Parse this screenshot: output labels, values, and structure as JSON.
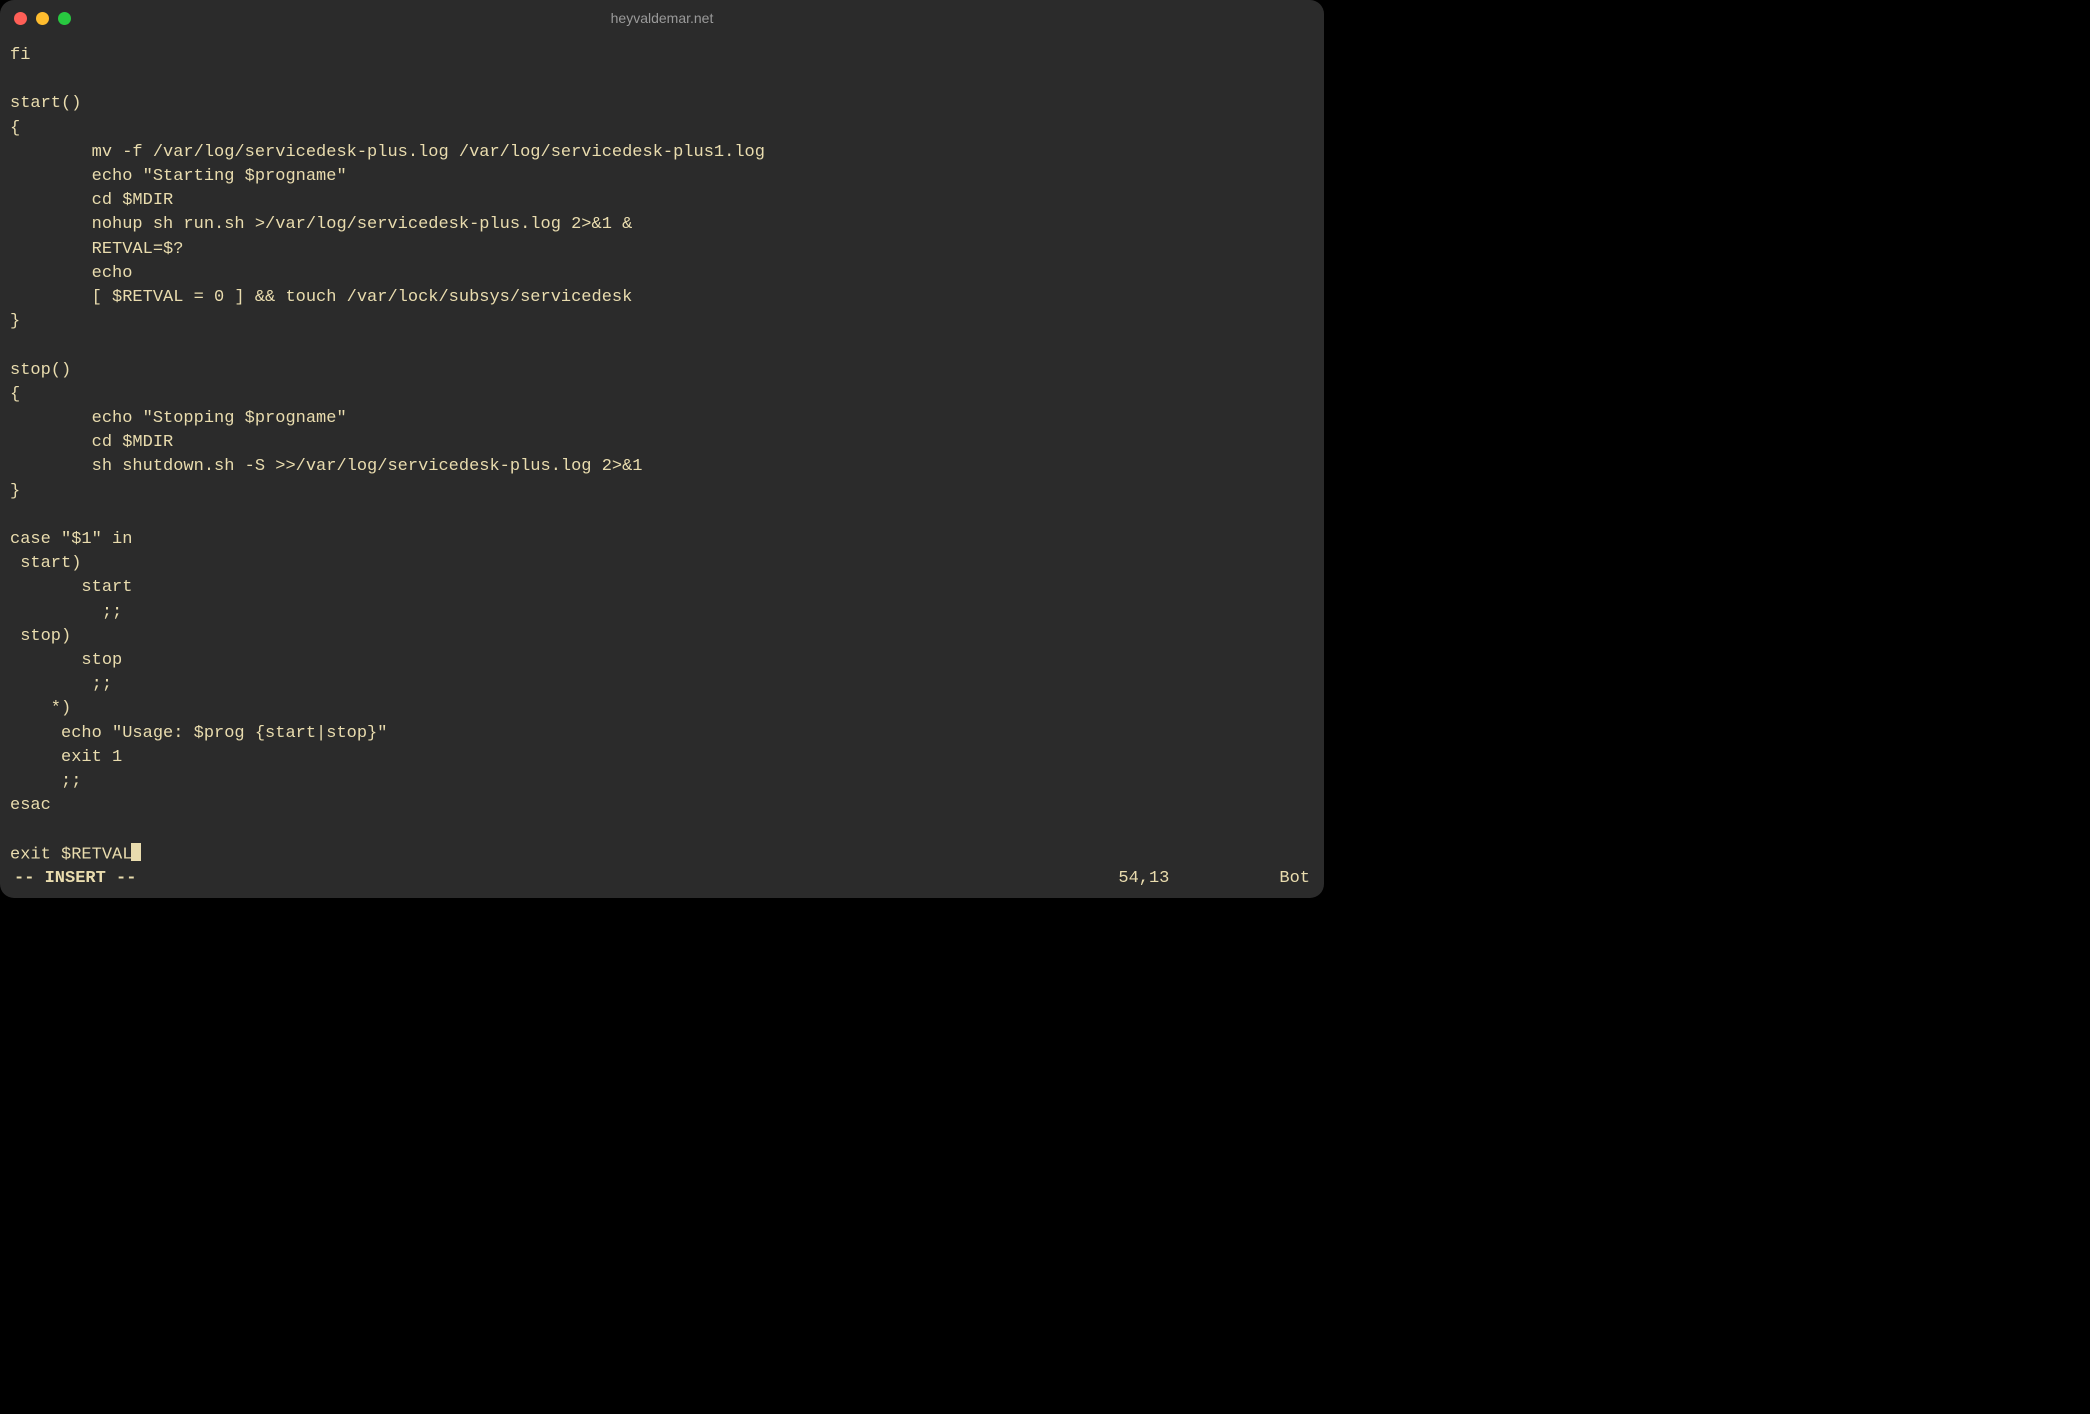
{
  "window": {
    "title": "heyvaldemar.net"
  },
  "editor": {
    "lines": [
      "fi",
      "",
      "start()",
      "{",
      "        mv -f /var/log/servicedesk-plus.log /var/log/servicedesk-plus1.log",
      "        echo \"Starting $progname\"",
      "        cd $MDIR",
      "        nohup sh run.sh >/var/log/servicedesk-plus.log 2>&1 &",
      "        RETVAL=$?",
      "        echo",
      "        [ $RETVAL = 0 ] && touch /var/lock/subsys/servicedesk",
      "}",
      "",
      "stop()",
      "{",
      "        echo \"Stopping $progname\"",
      "        cd $MDIR",
      "        sh shutdown.sh -S >>/var/log/servicedesk-plus.log 2>&1",
      "}",
      "",
      "case \"$1\" in",
      " start)",
      "       start",
      "         ;;",
      " stop)",
      "       stop",
      "        ;;",
      "    *)",
      "     echo \"Usage: $prog {start|stop}\"",
      "     exit 1",
      "     ;;",
      "esac",
      "",
      "exit $RETVAL"
    ]
  },
  "status": {
    "mode": "-- INSERT --",
    "position": "54,13",
    "scroll": "Bot"
  }
}
